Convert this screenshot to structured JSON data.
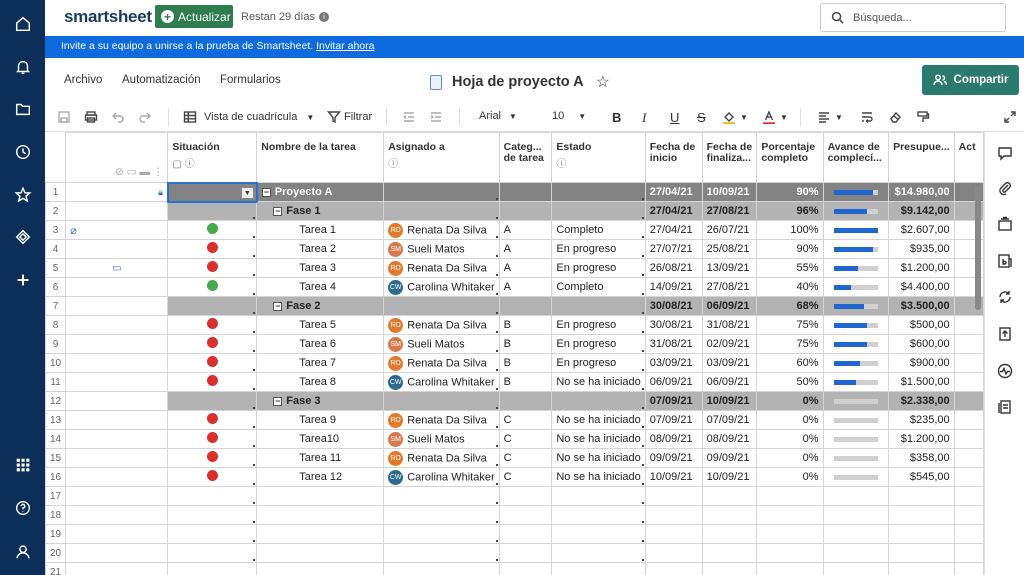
{
  "brand": {
    "logo": "smartsheet",
    "upgrade": "Actualizar",
    "trial": "Restan 29 días",
    "search_placeholder": "Búsqueda..."
  },
  "banner": {
    "text": "Invite a su equipo a unirse a la prueba de Smartsheet.",
    "link": "Invitar ahora"
  },
  "menu": {
    "archivo": "Archivo",
    "automatizacion": "Automatización",
    "formularios": "Formularios"
  },
  "sheet_title": "Hoja de proyecto A",
  "share_label": "Compartir",
  "toolbar": {
    "view": "Vista de cuadrícula",
    "filter": "Filtrar",
    "font": "Arial",
    "size": "10"
  },
  "columns": {
    "situacion": "Situación",
    "tarea": "Nombre de la tarea",
    "asignado": "Asignado a",
    "categoria": "Categ... de tarea",
    "estado": "Estado",
    "inicio": "Fecha de inicio",
    "finalizacion": "Fecha de finaliza...",
    "porcentaje": "Porcentaje completo",
    "avance": "Avance de complecí...",
    "presupuesto": "Presupue...",
    "act": "Act"
  },
  "colors": {
    "nav": "#0c2f5a",
    "banner": "#0d6bdf",
    "share": "#2b7a6e",
    "upgrade": "#2e7d4f",
    "red": "#d93030",
    "green": "#46a94a",
    "progress": "#1f66d1"
  },
  "rows": [
    {
      "n": "1",
      "kind": "proj",
      "task": "Proyecto A",
      "start": "27/04/21",
      "end": "10/09/21",
      "pct": "90%",
      "progress": 0.9,
      "budget": "$14.980,00"
    },
    {
      "n": "2",
      "kind": "fase",
      "task": "Fase 1",
      "start": "27/04/21",
      "end": "27/08/21",
      "pct": "96%",
      "progress": 0.76,
      "budget": "$9.142,00"
    },
    {
      "n": "3",
      "kind": "task",
      "status": "green",
      "task": "Tarea 1",
      "initials": "RD",
      "assignee": "Renata Da Silva",
      "cat": "A",
      "estado": "Completo",
      "start": "27/04/21",
      "end": "26/07/21",
      "pct": "100%",
      "progress": 1,
      "budget": "$2.607,00",
      "icon": "attachment"
    },
    {
      "n": "4",
      "kind": "task",
      "status": "red",
      "task": "Tarea 2",
      "initials": "SM",
      "assignee": "Sueli Matos",
      "cat": "A",
      "estado": "En progreso",
      "start": "27/07/21",
      "end": "25/08/21",
      "pct": "90%",
      "progress": 0.9,
      "budget": "$935,00"
    },
    {
      "n": "5",
      "kind": "task",
      "status": "red",
      "task": "Tarea 3",
      "initials": "RD",
      "assignee": "Renata Da Silva",
      "cat": "A",
      "estado": "En progreso",
      "start": "26/08/21",
      "end": "13/09/21",
      "pct": "55%",
      "progress": 0.55,
      "budget": "$1.200,00",
      "icon": "comment"
    },
    {
      "n": "6",
      "kind": "task",
      "status": "green",
      "task": "Tarea 4",
      "initials": "CW",
      "assignee": "Carolina Whitaker",
      "cat": "A",
      "estado": "Completo",
      "start": "14/09/21",
      "end": "27/08/21",
      "pct": "40%",
      "progress": 0.4,
      "budget": "$4.400,00"
    },
    {
      "n": "7",
      "kind": "fase",
      "task": "Fase 2",
      "start": "30/08/21",
      "end": "06/09/21",
      "pct": "68%",
      "progress": 0.68,
      "budget": "$3.500,00"
    },
    {
      "n": "8",
      "kind": "task",
      "status": "red",
      "task": "Tarea 5",
      "initials": "RD",
      "assignee": "Renata Da Silva",
      "cat": "B",
      "estado": "En progreso",
      "start": "30/08/21",
      "end": "31/08/21",
      "pct": "75%",
      "progress": 0.75,
      "budget": "$500,00"
    },
    {
      "n": "9",
      "kind": "task",
      "status": "red",
      "task": "Tarea 6",
      "initials": "SM",
      "assignee": "Sueli Matos",
      "cat": "B",
      "estado": "En progreso",
      "start": "31/08/21",
      "end": "02/09/21",
      "pct": "75%",
      "progress": 0.75,
      "budget": "$600,00"
    },
    {
      "n": "10",
      "kind": "task",
      "status": "red",
      "task": "Tarea 7",
      "initials": "RD",
      "assignee": "Renata Da Silva",
      "cat": "B",
      "estado": "En progreso",
      "start": "03/09/21",
      "end": "03/09/21",
      "pct": "60%",
      "progress": 0.6,
      "budget": "$900,00"
    },
    {
      "n": "11",
      "kind": "task",
      "status": "red",
      "task": "Tarea 8",
      "initials": "CW",
      "assignee": "Carolina Whitaker",
      "cat": "B",
      "estado": "No se ha iniciado",
      "start": "06/09/21",
      "end": "06/09/21",
      "pct": "50%",
      "progress": 0.5,
      "budget": "$1.500,00"
    },
    {
      "n": "12",
      "kind": "fase",
      "task": "Fase 3",
      "start": "07/09/21",
      "end": "10/09/21",
      "pct": "0%",
      "progress": 0,
      "budget": "$2.338,00"
    },
    {
      "n": "13",
      "kind": "task",
      "status": "red",
      "task": "Tarea 9",
      "initials": "RD",
      "assignee": "Renata Da Silva",
      "cat": "C",
      "estado": "No se ha iniciado",
      "start": "07/09/21",
      "end": "07/09/21",
      "pct": "0%",
      "progress": 0,
      "budget": "$235,00"
    },
    {
      "n": "14",
      "kind": "task",
      "status": "red",
      "task": "Tarea10",
      "initials": "SM",
      "assignee": "Sueli Matos",
      "cat": "C",
      "estado": "No se ha iniciado",
      "start": "08/09/21",
      "end": "08/09/21",
      "pct": "0%",
      "progress": 0,
      "budget": "$1.200,00"
    },
    {
      "n": "15",
      "kind": "task",
      "status": "red",
      "task": "Tarea 11",
      "initials": "RD",
      "assignee": "Renata Da Silva",
      "cat": "C",
      "estado": "No se ha iniciado",
      "start": "09/09/21",
      "end": "09/09/21",
      "pct": "0%",
      "progress": 0,
      "budget": "$358,00"
    },
    {
      "n": "16",
      "kind": "task",
      "status": "red",
      "task": "Tarea 12",
      "initials": "CW",
      "assignee": "Carolina Whitaker",
      "cat": "C",
      "estado": "No se ha iniciado",
      "start": "10/09/21",
      "end": "10/09/21",
      "pct": "0%",
      "progress": 0,
      "budget": "$545,00"
    },
    {
      "n": "17",
      "kind": "empty"
    },
    {
      "n": "18",
      "kind": "empty"
    },
    {
      "n": "19",
      "kind": "empty"
    },
    {
      "n": "20",
      "kind": "empty"
    },
    {
      "n": "21",
      "kind": "empty"
    }
  ]
}
